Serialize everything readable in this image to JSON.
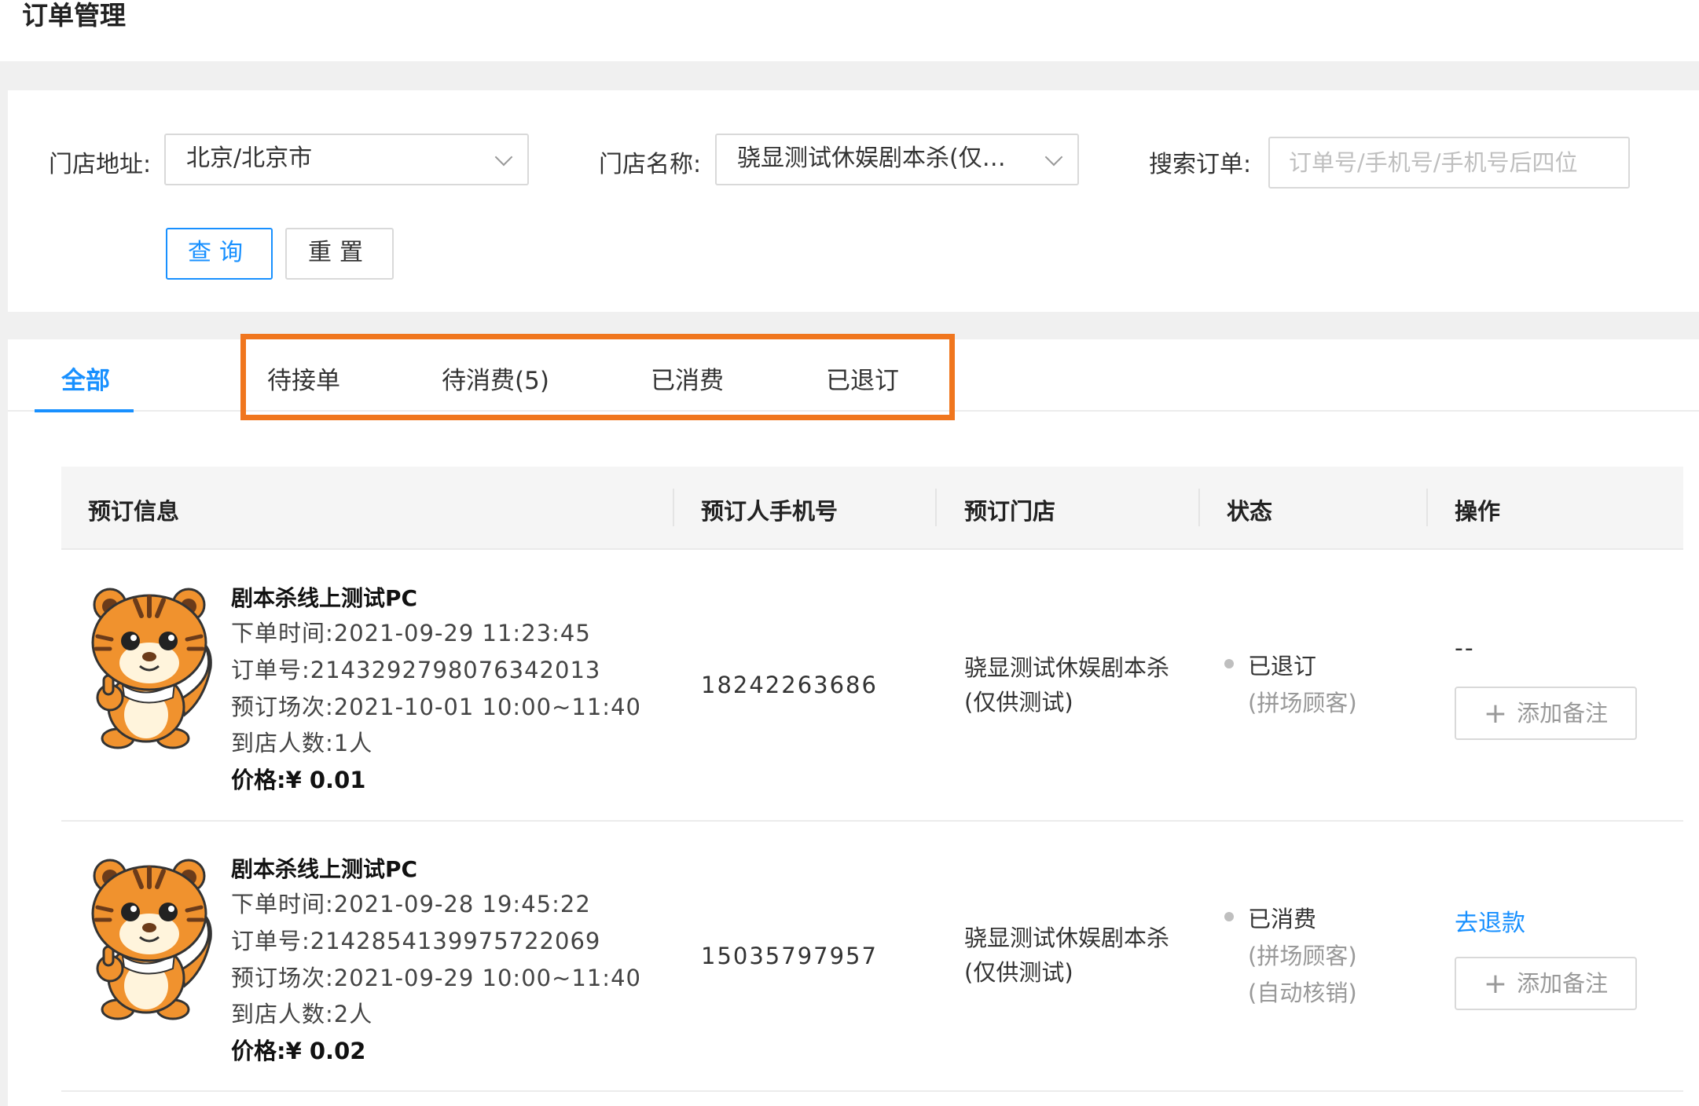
{
  "page": {
    "title": "订单管理"
  },
  "filters": {
    "address_label": "门店地址:",
    "address_value": "北京/北京市",
    "store_label": "门店名称:",
    "store_value": "骁显测试休娱剧本杀(仅供...",
    "search_label": "搜索订单:",
    "search_placeholder": "订单号/手机号/手机号后四位",
    "search_value": "",
    "query_button": "查询",
    "reset_button": "重置"
  },
  "tabs": [
    {
      "label": "全部",
      "active": true
    },
    {
      "label": "待接单",
      "active": false
    },
    {
      "label": "待消费(5)",
      "active": false
    },
    {
      "label": "已消费",
      "active": false
    },
    {
      "label": "已退订",
      "active": false
    }
  ],
  "highlight_color": "#f0761e",
  "accent_color": "#1890ff",
  "table": {
    "columns": [
      "预订信息",
      "预订人手机号",
      "预订门店",
      "状态",
      "操作"
    ],
    "rows": [
      {
        "image_icon": "tiger-mascot-icon",
        "product_name": "剧本杀线上测试PC",
        "order_time_label": "下单时间:",
        "order_time": "2021-09-29 11:23:45",
        "order_no_label": "订单号:",
        "order_no": "2143292798076342013",
        "session_label": "预订场次:",
        "session": "2021-10-01 10:00~11:40",
        "people_label": "到店人数:",
        "people": "1人",
        "price_label": "价格:",
        "price": "¥ 0.01",
        "phone": "18242263686",
        "store_line1": "骁显测试休娱剧本杀",
        "store_line2": "(仅供测试)",
        "status": "已退订",
        "sub_status": [
          "(拼场顾客)"
        ],
        "action_primary": "--",
        "note_button": "添加备注"
      },
      {
        "image_icon": "tiger-mascot-icon",
        "product_name": "剧本杀线上测试PC",
        "order_time_label": "下单时间:",
        "order_time": "2021-09-28 19:45:22",
        "order_no_label": "订单号:",
        "order_no": "2142854139975722069",
        "session_label": "预订场次:",
        "session": "2021-09-29 10:00~11:40",
        "people_label": "到店人数:",
        "people": "2人",
        "price_label": "价格:",
        "price": "¥ 0.02",
        "phone": "15035797957",
        "store_line1": "骁显测试休娱剧本杀",
        "store_line2": "(仅供测试)",
        "status": "已消费",
        "sub_status": [
          "(拼场顾客)",
          "(自动核销)"
        ],
        "action_primary": "去退款",
        "note_button": "添加备注"
      }
    ]
  }
}
